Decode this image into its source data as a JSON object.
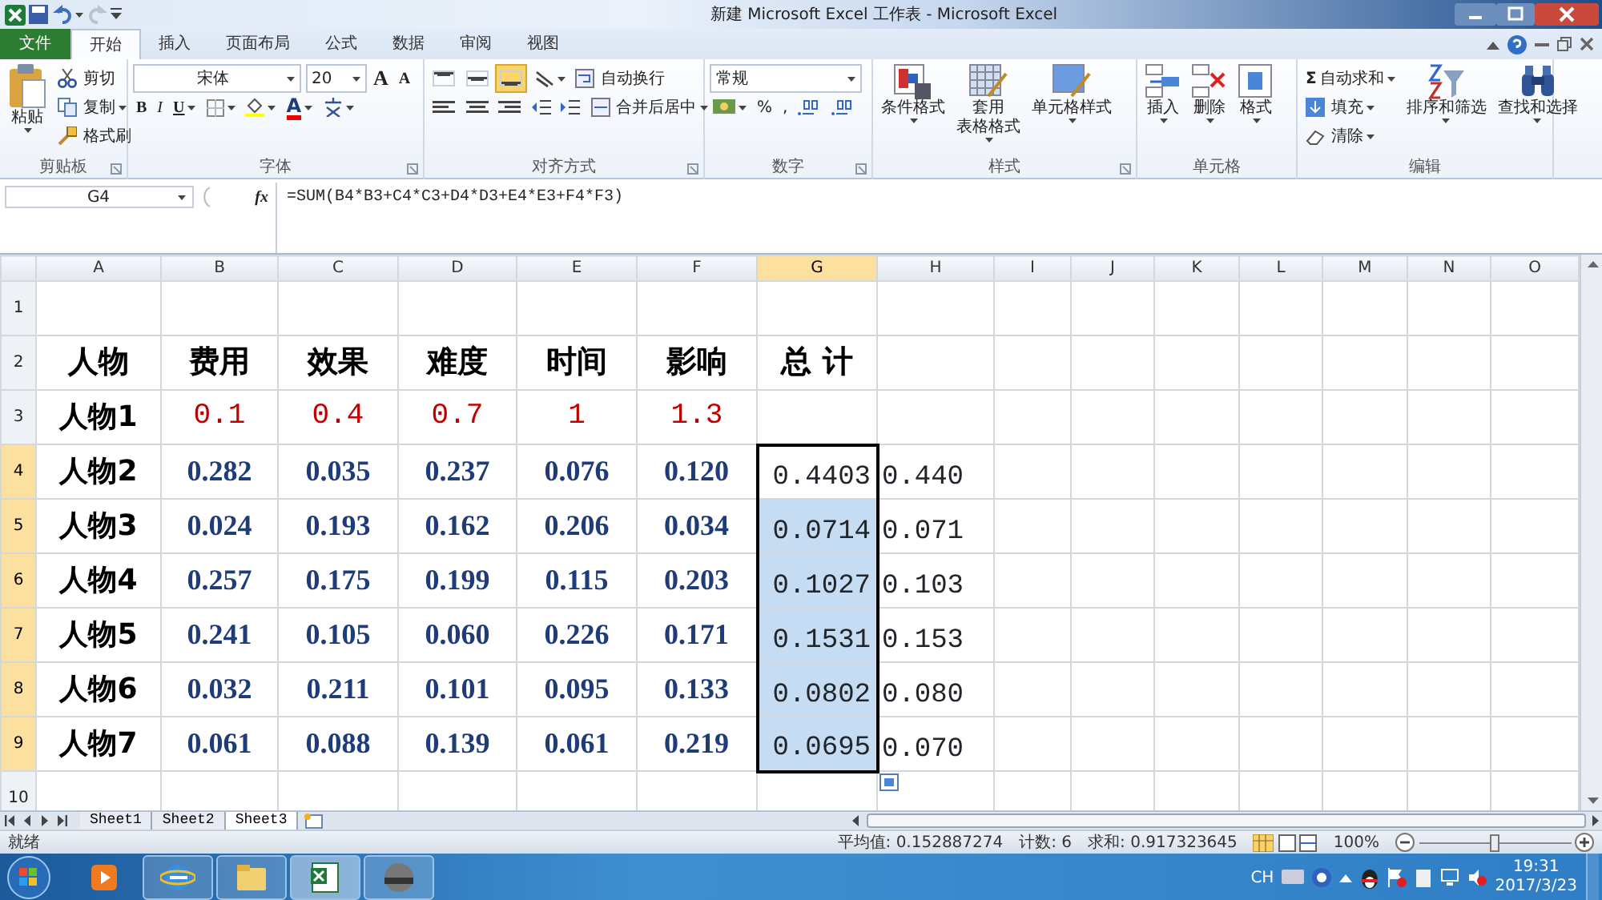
{
  "window": {
    "title": "新建 Microsoft Excel 工作表 - Microsoft Excel"
  },
  "tabs": [
    {
      "label": "文件",
      "kind": "file",
      "selected": false
    },
    {
      "label": "开始",
      "kind": "tab",
      "selected": true
    },
    {
      "label": "插入",
      "kind": "tab",
      "selected": false
    },
    {
      "label": "页面布局",
      "kind": "tab",
      "selected": false
    },
    {
      "label": "公式",
      "kind": "tab",
      "selected": false
    },
    {
      "label": "数据",
      "kind": "tab",
      "selected": false
    },
    {
      "label": "审阅",
      "kind": "tab",
      "selected": false
    },
    {
      "label": "视图",
      "kind": "tab",
      "selected": false
    }
  ],
  "ribbon": {
    "clipboard": {
      "title": "剪贴板",
      "paste": "粘贴",
      "items": [
        "剪切",
        "复制",
        "格式刷"
      ]
    },
    "font": {
      "title": "字体",
      "font_name": "宋体",
      "font_size": "20",
      "grow": "A",
      "shrink": "A",
      "bold": "B",
      "italic": "I",
      "underline": "U",
      "color_letter": "A"
    },
    "alignment": {
      "title": "对齐方式",
      "vertical": [
        {
          "selected": false
        },
        {
          "selected": false
        },
        {
          "selected": true
        }
      ],
      "wrap": "自动换行",
      "merge": "合并后居中"
    },
    "number": {
      "title": "数字",
      "format": "常规",
      "percent": "%",
      "comma": ","
    },
    "styles": {
      "title": "样式",
      "items": [
        [
          "条件格式"
        ],
        [
          "套用",
          "表格格式"
        ],
        [
          "单元格样式"
        ]
      ]
    },
    "cells": {
      "title": "单元格",
      "items": [
        "插入",
        "删除",
        "格式"
      ]
    },
    "editing": {
      "title": "编辑",
      "sigma": "Σ",
      "small": [
        "自动求和",
        "填充",
        "清除"
      ],
      "large": [
        "排序和筛选",
        "查找和选择"
      ]
    }
  },
  "formula_bar": {
    "name_box": "G4",
    "fx": "fx",
    "formula": "=SUM(B4*B3+C4*C3+D4*D3+E4*E3+F4*F3)"
  },
  "sheet": {
    "columns": [
      {
        "label": "A",
        "selected": false
      },
      {
        "label": "B",
        "selected": false
      },
      {
        "label": "C",
        "selected": false
      },
      {
        "label": "D",
        "selected": false
      },
      {
        "label": "E",
        "selected": false
      },
      {
        "label": "F",
        "selected": false
      },
      {
        "label": "G",
        "selected": true
      },
      {
        "label": "H",
        "selected": false
      },
      {
        "label": "I",
        "selected": false
      },
      {
        "label": "J",
        "selected": false
      },
      {
        "label": "K",
        "selected": false
      },
      {
        "label": "L",
        "selected": false
      },
      {
        "label": "M",
        "selected": false
      },
      {
        "label": "N",
        "selected": false
      },
      {
        "label": "O",
        "selected": false
      }
    ],
    "rows": [
      {
        "number": "1",
        "kind": "blank",
        "selected": false
      },
      {
        "number": "2",
        "kind": "header",
        "selected": false,
        "label": "人物",
        "values": [
          "费用",
          "效果",
          "难度",
          "时间",
          "影响"
        ],
        "total": "总 计"
      },
      {
        "number": "3",
        "kind": "weight",
        "selected": false,
        "label": "人物1",
        "values": [
          "0.1",
          "0.4",
          "0.7",
          "1",
          "1.3"
        ]
      },
      {
        "number": "4",
        "kind": "data",
        "selected": true,
        "active": true,
        "label": "人物2",
        "values": [
          "0.282",
          "0.035",
          "0.237",
          "0.076",
          "0.120"
        ],
        "total": "0.4403",
        "rounded": "0.440"
      },
      {
        "number": "5",
        "kind": "data",
        "selected": true,
        "active": false,
        "label": "人物3",
        "values": [
          "0.024",
          "0.193",
          "0.162",
          "0.206",
          "0.034"
        ],
        "total": "0.0714",
        "rounded": "0.071"
      },
      {
        "number": "6",
        "kind": "data",
        "selected": true,
        "active": false,
        "label": "人物4",
        "values": [
          "0.257",
          "0.175",
          "0.199",
          "0.115",
          "0.203"
        ],
        "total": "0.1027",
        "rounded": "0.103"
      },
      {
        "number": "7",
        "kind": "data",
        "selected": true,
        "active": false,
        "label": "人物5",
        "values": [
          "0.241",
          "0.105",
          "0.060",
          "0.226",
          "0.171"
        ],
        "total": "0.1531",
        "rounded": "0.153"
      },
      {
        "number": "8",
        "kind": "data",
        "selected": true,
        "active": false,
        "label": "人物6",
        "values": [
          "0.032",
          "0.211",
          "0.101",
          "0.095",
          "0.133"
        ],
        "total": "0.0802",
        "rounded": "0.080"
      },
      {
        "number": "9",
        "kind": "data",
        "selected": true,
        "active": false,
        "label": "人物7",
        "values": [
          "0.061",
          "0.088",
          "0.139",
          "0.061",
          "0.219"
        ],
        "total": "0.0695",
        "rounded": "0.070"
      },
      {
        "number": "10",
        "kind": "blank",
        "selected": false
      }
    ]
  },
  "sheet_tabs": [
    {
      "label": "Sheet1",
      "selected": false
    },
    {
      "label": "Sheet2",
      "selected": false
    },
    {
      "label": "Sheet3",
      "selected": true
    }
  ],
  "status_bar": {
    "ready": "就绪",
    "average": "平均值: 0.152887274",
    "count": "计数: 6",
    "sum": "求和: 0.917323645",
    "zoom": "100%",
    "zoom_slider": {
      "level": 0.5
    }
  },
  "taskbar": {
    "apps": [
      {
        "running": false,
        "active": false
      },
      {
        "running": true,
        "active": false
      },
      {
        "running": true,
        "active": false
      },
      {
        "running": true,
        "active": true
      },
      {
        "running": true,
        "active": false
      }
    ],
    "language": "CH",
    "time": "19:31",
    "date": "2017/3/23"
  }
}
